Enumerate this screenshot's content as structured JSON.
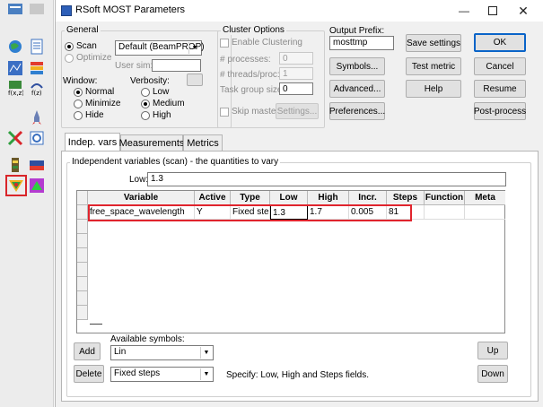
{
  "window": {
    "title": "RSoft MOST Parameters"
  },
  "general": {
    "legend": "General",
    "scan_label": "Scan",
    "optimize_label": "Optimize",
    "scan_selected": true,
    "engine": "Default (BeamPROP)",
    "user_sim_label": "User sim:",
    "user_sim_value": "",
    "window_label": "Window:",
    "window_options": [
      "Normal",
      "Minimize",
      "Hide"
    ],
    "window_selected": "Normal",
    "verbosity_label": "Verbosity:",
    "verbosity_options": [
      "Low",
      "Medium",
      "High"
    ],
    "verbosity_selected": "Medium"
  },
  "cluster": {
    "legend": "Cluster Options",
    "enable_label": "Enable Clustering",
    "processes_label": "# processes:",
    "processes_value": "0",
    "threads_label": "# threads/proc:",
    "threads_value": "1",
    "task_group_label": "Task group size:",
    "task_group_value": "0",
    "skip_master_label": "Skip master",
    "settings_label": "Settings..."
  },
  "output": {
    "prefix_label": "Output Prefix:",
    "prefix_value": "mosttmp"
  },
  "buttons": {
    "symbols": "Symbols...",
    "advanced": "Advanced...",
    "preferences": "Preferences...",
    "save_settings": "Save settings",
    "test_metric": "Test metric",
    "help": "Help",
    "ok": "OK",
    "cancel": "Cancel",
    "resume": "Resume",
    "post_process": "Post-process",
    "add": "Add",
    "delete": "Delete",
    "up": "Up",
    "down": "Down"
  },
  "tabs": [
    {
      "label": "Indep. vars",
      "active": true
    },
    {
      "label": "Measurements",
      "active": false
    },
    {
      "label": "Metrics",
      "active": false
    }
  ],
  "indep": {
    "legend": "Independent variables (scan) - the quantities to vary",
    "low_label": "Low:",
    "low_value": "1.3",
    "columns": [
      "Variable",
      "Active",
      "Type",
      "Low",
      "High",
      "Incr.",
      "Steps",
      "Function",
      "Meta"
    ],
    "rows": [
      {
        "variable": "free_space_wavelength",
        "active": "Y",
        "type": "Fixed steps",
        "low": "1.3",
        "high": "1.7",
        "incr": "0.005",
        "steps": "81",
        "function": "",
        "meta": ""
      }
    ],
    "available_symbols_label": "Available symbols:",
    "available_symbols_value": "Lin",
    "step_mode_value": "Fixed steps",
    "specify_text": "Specify: Low, High and Steps fields."
  },
  "colors": {
    "highlight": "#e0242d",
    "title_icon": "#2d5fb8",
    "default_border": "#0a64c8"
  }
}
